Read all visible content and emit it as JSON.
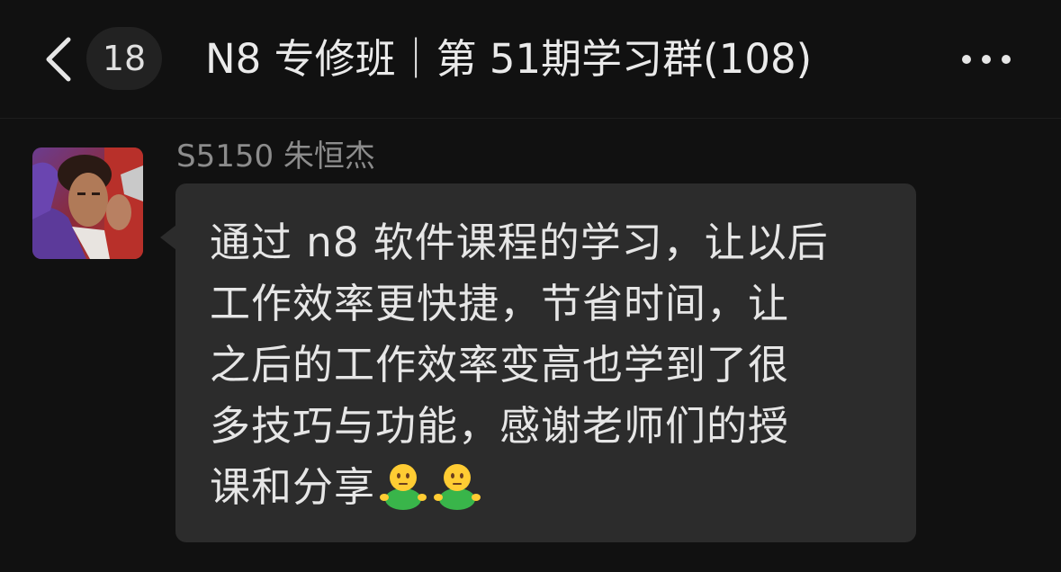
{
  "header": {
    "back_icon": "chevron-left-icon",
    "unread_count": "18",
    "title": "N8 专修班｜第 51期学习群(108)",
    "more_icon": "more-dots-icon"
  },
  "message": {
    "sender": "S5150 朱恒杰",
    "avatar_icon": "user-avatar-photo",
    "lines": [
      "通过 n8 软件课程的学习，让以后",
      "工作效率更快捷，节省时间，让",
      "之后的工作效率变高也学到了很",
      "多技巧与功能，感谢老师们的授",
      "课和分享"
    ],
    "emojis": [
      "person-shrugging-emoji",
      "person-shrugging-emoji"
    ],
    "colors": {
      "bubble": "#2c2c2c",
      "background": "#111111",
      "sender_name": "#8c8c8c"
    }
  }
}
